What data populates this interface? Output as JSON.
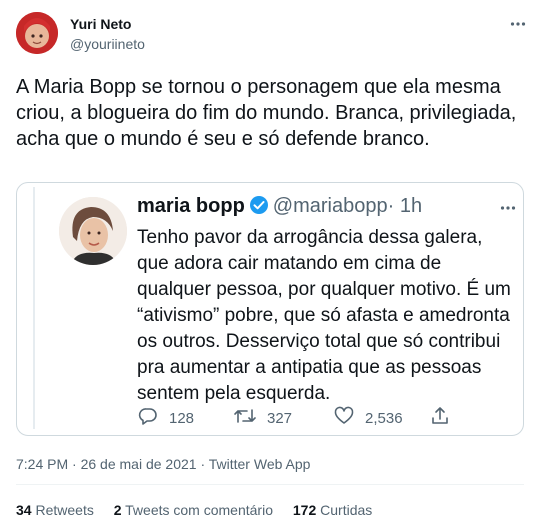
{
  "author": {
    "name": "Yuri Neto",
    "handle": "@youriineto"
  },
  "tweet_text": "A Maria Bopp se tornou o personagem que ela mesma criou, a blogueira do fim do mundo. Branca, privilegiada, acha que o mundo é seu e só defende branco.",
  "quoted": {
    "name": "maria bopp",
    "handle": "@mariabopp",
    "time": "· 1h",
    "text": "Tenho pavor da arrogância dessa galera, que adora cair matando em cima de qualquer pessoa, por qualquer motivo. É um “ativismo” pobre, que só afasta e amedronta os outros. Desserviço total que só contribui pra aumentar a antipatia que as pessoas sentem pela esquerda.",
    "replies": "128",
    "retweets": "327",
    "likes": "2,536"
  },
  "meta": "7:24 PM · 26 de mai de 2021 · Twitter Web App",
  "stats": {
    "retweets_count": "34",
    "retweets_label": "Retweets",
    "quotes_count": "2",
    "quotes_label": "Tweets com comentário",
    "likes_count": "172",
    "likes_label": "Curtidas"
  },
  "colors": {
    "text": "#0f1419",
    "secondary": "#536471",
    "border": "#cfd9de",
    "verified": "#1d9bf0"
  }
}
